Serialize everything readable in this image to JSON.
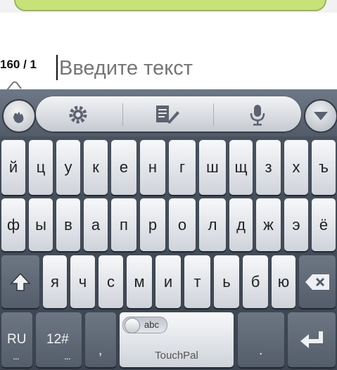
{
  "compose": {
    "counter": "160 / 1",
    "placeholder": "Введите текст"
  },
  "keyboard": {
    "row1": [
      "й",
      "ц",
      "у",
      "к",
      "е",
      "н",
      "г",
      "ш",
      "щ",
      "з",
      "х",
      "ъ"
    ],
    "row2": [
      "ф",
      "ы",
      "в",
      "а",
      "п",
      "р",
      "о",
      "л",
      "д",
      "ж",
      "э",
      "ё"
    ],
    "row3": [
      "я",
      "ч",
      "с",
      "м",
      "и",
      "т",
      "ь",
      "б",
      "ю"
    ],
    "lang_key": "RU",
    "lang_dots": "...",
    "sym_key": "12#",
    "sym_dots": "...",
    "comma_key": ",",
    "period_key": ".",
    "space_toggle": "abc",
    "space_label": "TouchPal"
  },
  "icons": {
    "logo": "touchpal-logo-icon",
    "settings": "gear-icon",
    "edit": "edit-icon",
    "voice": "microphone-icon",
    "collapse": "chevron-down-icon",
    "shift": "shift-icon",
    "backspace": "backspace-icon",
    "enter": "enter-icon"
  }
}
